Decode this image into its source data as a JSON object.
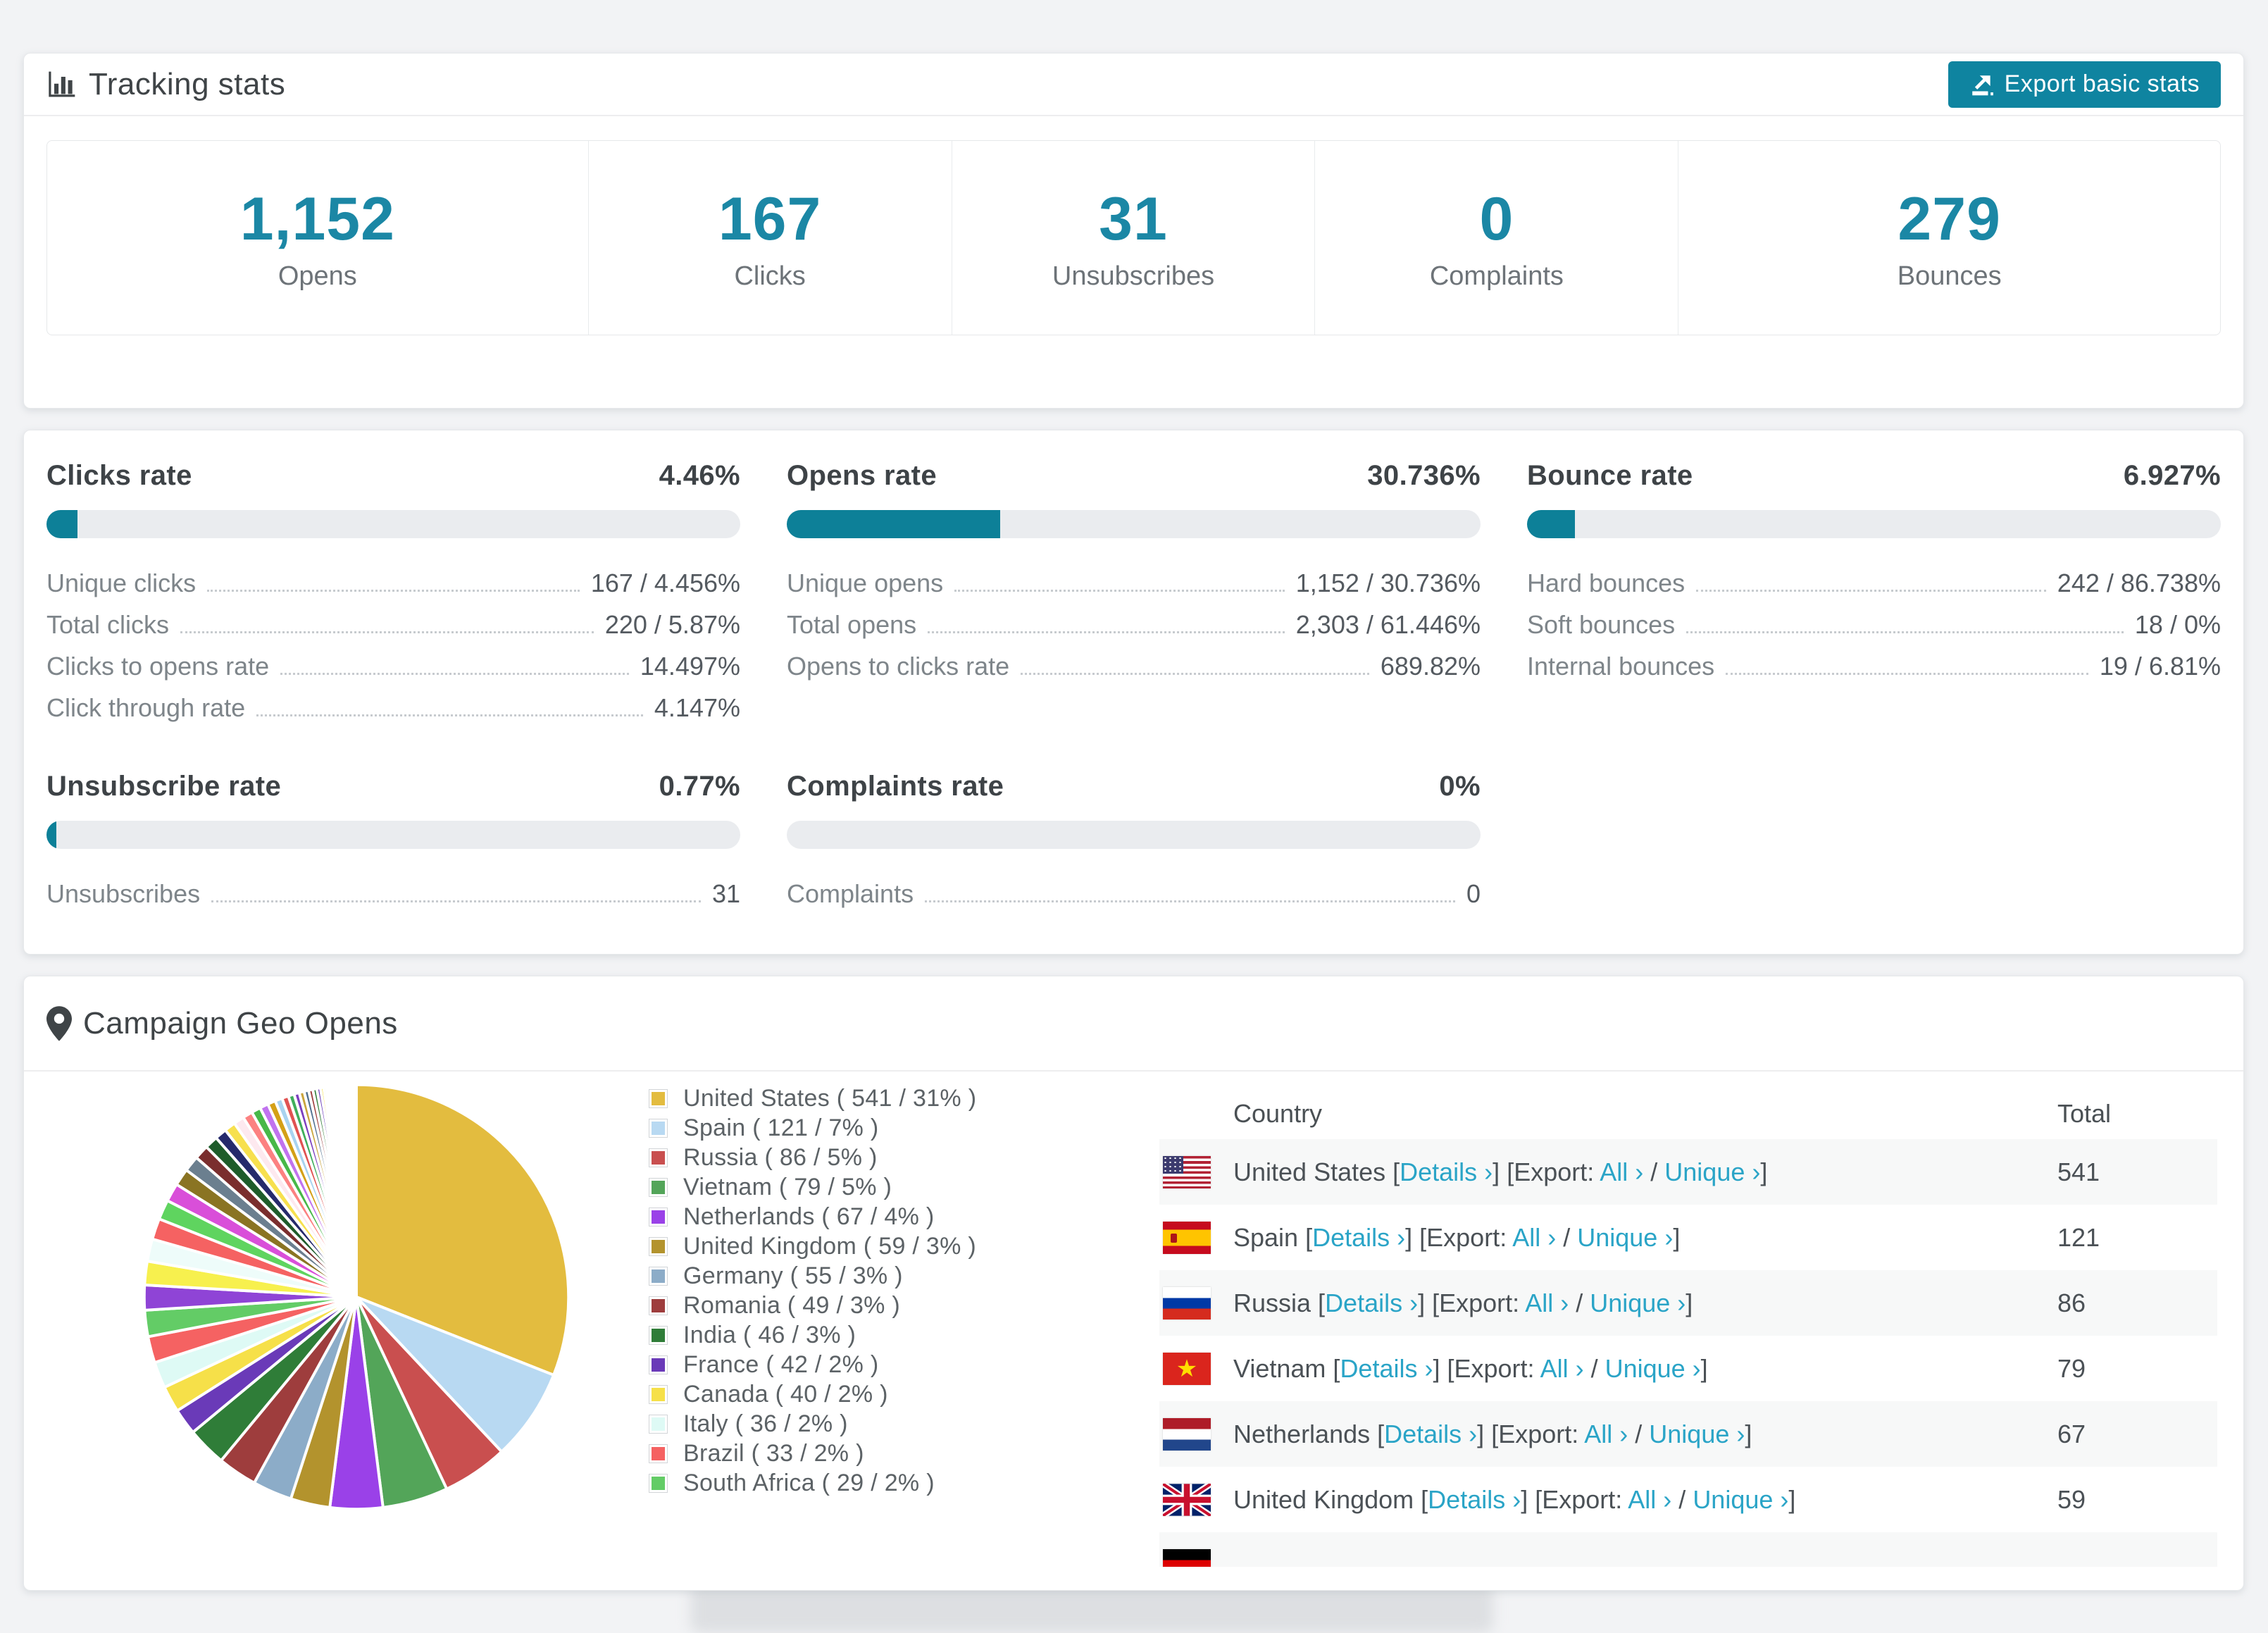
{
  "colors": {
    "accent_number": "#1b87a5",
    "bar_fill": "#0d8098",
    "bar_track": "#eaecef",
    "link": "#2aa4c7",
    "export_button_bg": "#0f84a0",
    "page_bg": "#f2f3f5",
    "striped_row_bg": "#f7f8f8"
  },
  "tracking": {
    "title": "Tracking stats",
    "export_button": "Export basic stats",
    "stats": [
      {
        "value": "1,152",
        "label": "Opens"
      },
      {
        "value": "167",
        "label": "Clicks"
      },
      {
        "value": "31",
        "label": "Unsubscribes"
      },
      {
        "value": "0",
        "label": "Complaints"
      },
      {
        "value": "279",
        "label": "Bounces"
      }
    ]
  },
  "rates": [
    {
      "title": "Clicks rate",
      "value": "4.46%",
      "percent": 4.46,
      "rows": [
        [
          "Unique clicks",
          "167 / 4.456%"
        ],
        [
          "Total clicks",
          "220 / 5.87%"
        ],
        [
          "Clicks to opens rate",
          "14.497%"
        ],
        [
          "Click through rate",
          "4.147%"
        ]
      ]
    },
    {
      "title": "Opens rate",
      "value": "30.736%",
      "percent": 30.736,
      "rows": [
        [
          "Unique opens",
          "1,152 / 30.736%"
        ],
        [
          "Total opens",
          "2,303 / 61.446%"
        ],
        [
          "Opens to clicks rate",
          "689.82%"
        ]
      ]
    },
    {
      "title": "Bounce rate",
      "value": "6.927%",
      "percent": 6.927,
      "rows": [
        [
          "Hard bounces",
          "242 / 86.738%"
        ],
        [
          "Soft bounces",
          "18 / 0%"
        ],
        [
          "Internal bounces",
          "19 / 6.81%"
        ]
      ]
    },
    {
      "title": "Unsubscribe rate",
      "value": "0.77%",
      "percent": 0.77,
      "rows": [
        [
          "Unsubscribes",
          "31"
        ]
      ]
    },
    {
      "title": "Complaints rate",
      "value": "0%",
      "percent": 0,
      "rows": [
        [
          "Complaints",
          "0"
        ]
      ]
    }
  ],
  "geo": {
    "title": "Campaign Geo Opens",
    "chart_data": {
      "type": "pie",
      "start_angle_deg": -90,
      "direction": "clockwise",
      "legend_position": "right-of-pie",
      "series": [
        {
          "name": "United States",
          "count": 541,
          "percent": 31,
          "color": "#e3bc3f",
          "flag": "us"
        },
        {
          "name": "Spain",
          "count": 121,
          "percent": 7,
          "color": "#b8d9f2",
          "flag": "es"
        },
        {
          "name": "Russia",
          "count": 86,
          "percent": 5,
          "color": "#c94f4f",
          "flag": "ru"
        },
        {
          "name": "Vietnam",
          "count": 79,
          "percent": 5,
          "color": "#53a559",
          "flag": "vn"
        },
        {
          "name": "Netherlands",
          "count": 67,
          "percent": 4,
          "color": "#9a41e8",
          "flag": "nl"
        },
        {
          "name": "United Kingdom",
          "count": 59,
          "percent": 3,
          "color": "#b3932d",
          "flag": "gb"
        },
        {
          "name": "Germany",
          "count": 55,
          "percent": 3,
          "color": "#8cacc8",
          "flag": "de"
        },
        {
          "name": "Romania",
          "count": 49,
          "percent": 3,
          "color": "#9e3d3d"
        },
        {
          "name": "India",
          "count": 46,
          "percent": 3,
          "color": "#2f7d38"
        },
        {
          "name": "France",
          "count": 42,
          "percent": 2,
          "color": "#6a3ab8"
        },
        {
          "name": "Canada",
          "count": 40,
          "percent": 2,
          "color": "#f6e049"
        },
        {
          "name": "Italy",
          "count": 36,
          "percent": 2,
          "color": "#defaf5"
        },
        {
          "name": "Brazil",
          "count": 33,
          "percent": 2,
          "color": "#f56262"
        },
        {
          "name": "South Africa",
          "count": 29,
          "percent": 2,
          "color": "#63cc66"
        }
      ],
      "others": {
        "note": "unlabeled long tail of small slices",
        "percents": [
          1.9,
          1.8,
          1.7,
          1.6,
          1.5,
          1.4,
          1.3,
          1.2,
          1.1,
          1.0,
          0.9,
          0.85,
          0.8,
          0.75,
          0.7,
          0.65,
          0.6,
          0.55,
          0.5,
          0.45,
          0.4,
          0.38,
          0.35,
          0.32,
          0.3,
          0.28,
          0.25,
          0.22,
          0.2,
          0.18,
          0.16,
          0.14,
          0.12,
          0.1,
          0.09,
          0.08,
          0.07,
          0.06,
          0.05,
          0.05
        ],
        "colors": [
          "#8f44d6",
          "#f7f04e",
          "#eefcfa",
          "#f56262",
          "#5fd45f",
          "#d94fd9",
          "#8a7423",
          "#6b7f8f",
          "#7a2e2e",
          "#1e5c2a",
          "#252a6b",
          "#f7e04e",
          "#fde9ef",
          "#fc8181",
          "#48b848",
          "#c173ef",
          "#d4a017",
          "#a8d3f0",
          "#e05252",
          "#3fae5c",
          "#7b3fbf",
          "#caa53d",
          "#4f6f8f",
          "#9e3d3d",
          "#2f7d38",
          "#6a3ab8",
          "#f6e049",
          "#defaf5",
          "#f56262",
          "#63cc66",
          "#e3bc3f",
          "#b8d9f2",
          "#c94f4f",
          "#53a559",
          "#9a41e8",
          "#b3932d",
          "#8cacc8",
          "#a03d3d",
          "#2e7d32",
          "#6839b5"
        ]
      }
    },
    "table": {
      "columns": [
        "Country",
        "Total"
      ],
      "links": {
        "lb": " [",
        "details": "Details ›",
        "rb": "] ",
        "export_prefix": "[Export: ",
        "all": "All ›",
        "slash": " / ",
        "unique": "Unique ›",
        "rb2": "]"
      },
      "rows": [
        {
          "name": "United States",
          "total": "541",
          "flag": "us"
        },
        {
          "name": "Spain",
          "total": "121",
          "flag": "es"
        },
        {
          "name": "Russia",
          "total": "86",
          "flag": "ru"
        },
        {
          "name": "Vietnam",
          "total": "79",
          "flag": "vn"
        },
        {
          "name": "Netherlands",
          "total": "67",
          "flag": "nl"
        },
        {
          "name": "United Kingdom",
          "total": "59",
          "flag": "gb"
        }
      ],
      "partial_row_flag": "de"
    }
  }
}
